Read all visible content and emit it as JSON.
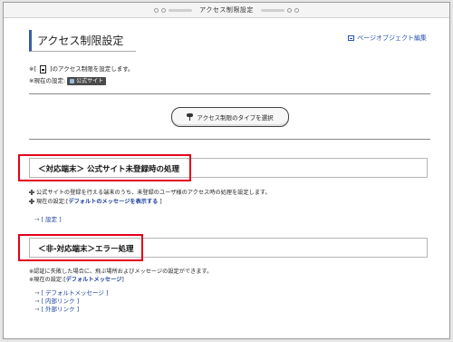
{
  "window": {
    "title": "アクセス制限設定"
  },
  "header": {
    "page_title": "アクセス制限設定",
    "edit_link": "ページオブジェクト編集"
  },
  "info": {
    "line1_prefix": "※[",
    "line1_suffix": "]のアクセス制限を設定します。",
    "line2_prefix": "※現在の設定:",
    "line2_badge": "公式サイト"
  },
  "type_button": {
    "label": "アクセス制限のタイプを選択"
  },
  "section1": {
    "heading": "＜対応端末＞ 公式サイト未登録時の処理",
    "desc1": "公式サイトの登録を行える端末のうち、未登録のユーザ様のアクセス時の処理を設定します。",
    "desc2_prefix": "現在の設定:[",
    "desc2_value": "デフォルトのメッセージを表示する",
    "desc2_suffix": " ]",
    "link": "[ 設定 ]"
  },
  "section2": {
    "heading": "＜非-対応端末＞エラー処理",
    "desc1": "※認証に失敗した場合に、飛ぶ場所およびメッセージの設定ができます。",
    "desc2_prefix": "※現在の設定:[",
    "desc2_value": "デフォルトメッセージ",
    "desc2_suffix": "]",
    "links": [
      "[ デフォルトメッセージ ]",
      "[ 内部リンク ]",
      "[ 外部リンク ]"
    ]
  },
  "colors": {
    "highlight": "#e3001b",
    "link": "#1b3f9e",
    "accent": "#3a5da8"
  }
}
